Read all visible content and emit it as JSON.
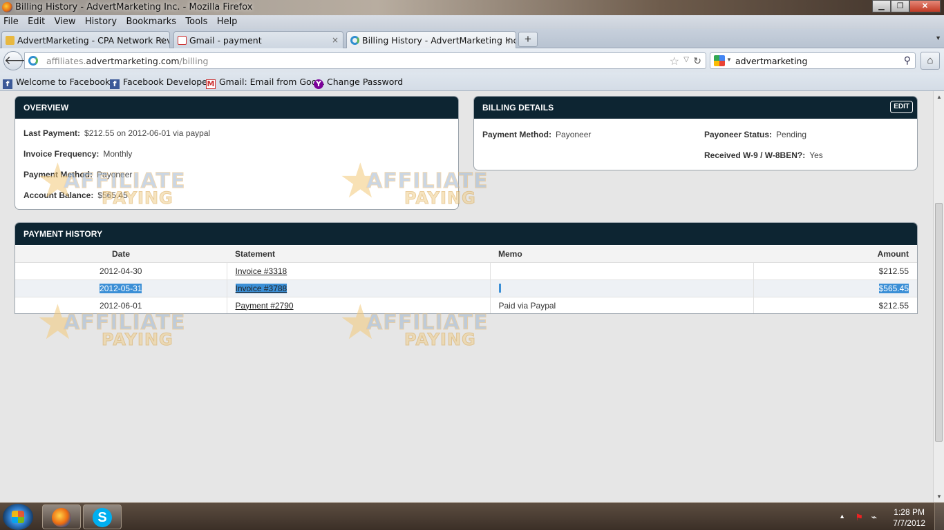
{
  "window": {
    "title": "Billing History - AdvertMarketing Inc. - Mozilla Firefox"
  },
  "menu": [
    "File",
    "Edit",
    "View",
    "History",
    "Bookmarks",
    "Tools",
    "Help"
  ],
  "tabs": [
    {
      "label": "AdvertMarketing - CPA Network Revi...",
      "close": "×"
    },
    {
      "label": "Gmail - payment",
      "close": "×"
    },
    {
      "label": "Billing History - AdvertMarketing Inc.",
      "close": "×"
    }
  ],
  "newtab": "+",
  "nav": {
    "url_prefix": "affiliates.",
    "url_domain": "advertmarketing.com",
    "url_path": "/billing",
    "search_value": "advertmarketing"
  },
  "bookmarks": [
    {
      "label": "Welcome to Facebook...",
      "icon": "facebook-icon"
    },
    {
      "label": "Facebook Developers",
      "icon": "facebook-icon"
    },
    {
      "label": "Gmail: Email from Goo...",
      "icon": "gmail-icon"
    },
    {
      "label": "Change Password",
      "icon": "yahoo-icon"
    }
  ],
  "overview": {
    "title": "OVERVIEW",
    "last_payment_label": "Last Payment:",
    "last_payment_value": "$212.55 on 2012-06-01 via paypal",
    "invoice_frequency_label": "Invoice Frequency:",
    "invoice_frequency_value": "Monthly",
    "payment_method_label": "Payment Method:",
    "payment_method_value": "Payoneer",
    "account_balance_label": "Account Balance:",
    "account_balance_value": "$565.45"
  },
  "billing_details": {
    "title": "BILLING DETAILS",
    "edit_label": "EDIT",
    "payment_method_label": "Payment Method:",
    "payment_method_value": "Payoneer",
    "payoneer_status_label": "Payoneer Status:",
    "payoneer_status_value": "Pending",
    "w9_label": "Received W-9 / W-8BEN?:",
    "w9_value": "Yes"
  },
  "payment_history": {
    "title": "PAYMENT HISTORY",
    "columns": [
      "Date",
      "Statement",
      "Memo",
      "Amount"
    ],
    "rows": [
      {
        "date": "2012-04-30",
        "statement": "Invoice #3318",
        "memo": "",
        "amount": "$212.55"
      },
      {
        "date": "2012-05-31",
        "statement": "Invoice #3788",
        "memo": "",
        "amount": "$565.45"
      },
      {
        "date": "2012-06-01",
        "statement": "Payment #2790",
        "memo": "Paid via Paypal",
        "amount": "$212.55"
      }
    ]
  },
  "watermark": {
    "line1": "AFFILIATE",
    "line2": "PAYING"
  },
  "taskbar": {
    "time": "1:28 PM",
    "date": "7/7/2012"
  },
  "colors": {
    "panel_header": "#0d2532",
    "selection": "#3b8fd6",
    "page_bg": "#e6e6e6"
  }
}
